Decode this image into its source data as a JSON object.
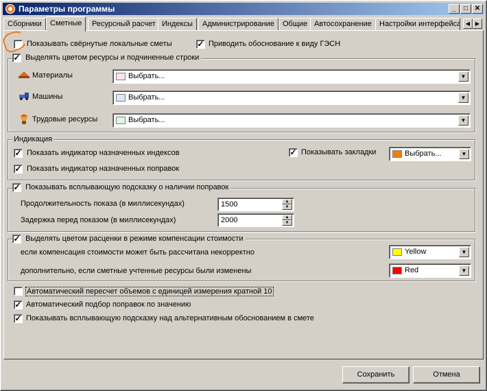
{
  "window": {
    "title": "Параметры программы",
    "controls": {
      "minimize": "_",
      "maximize": "□",
      "close": "✕"
    }
  },
  "tabs": [
    {
      "label": "Сборники"
    },
    {
      "label": "Сметные",
      "active": true
    },
    {
      "label": "Ресурсный расчет"
    },
    {
      "label": "Индексы"
    },
    {
      "label": "Администрирование"
    },
    {
      "label": "Общие"
    },
    {
      "label": "Автосохранение"
    },
    {
      "label": "Настройки интерфейса"
    }
  ],
  "options": {
    "show_collapsed": {
      "label": "Показывать свёрнутые локальные сметы",
      "checked": false
    },
    "gesn_basis": {
      "label": "Приводить обоснование к виду ГЭСН",
      "checked": true
    }
  },
  "highlight_group": {
    "label": "Выделять цветом ресурсы и подчиненные строки",
    "checked": true,
    "rows": [
      {
        "label": "Материалы",
        "icon": "materials-icon",
        "value": "Выбрать...",
        "color": "#fce4ec"
      },
      {
        "label": "Машины",
        "icon": "machines-icon",
        "value": "Выбрать...",
        "color": "#dde8f8"
      },
      {
        "label": "Трудовые ресурсы",
        "icon": "labor-icon",
        "value": "Выбрать...",
        "color": "#ddf5ea"
      }
    ]
  },
  "indication": {
    "title": "Индикация",
    "indexes": {
      "label": "Показать индикатор назначенных индексов",
      "checked": true
    },
    "corrections": {
      "label": "Показать индикатор назначенных поправок",
      "checked": true
    },
    "bookmarks": {
      "label": "Показывать закладки",
      "checked": true,
      "value": "Выбрать...",
      "color": "#f08000"
    }
  },
  "tooltip_group": {
    "label": "Показывать всплывающую подсказку о наличии поправок",
    "checked": true,
    "duration": {
      "label": "Продолжительность показа (в миллисекундах)",
      "value": "1500"
    },
    "delay": {
      "label": "Задержка перед показом (в миллисекундах)",
      "value": "2000"
    }
  },
  "compensation_group": {
    "label": "Выделять цветом расценки в режиме компенсации стоимости",
    "checked": true,
    "incorrect": {
      "label": "если компенсация стоимости может быть рассчитана некорректно",
      "value": "Yellow",
      "color": "#ffff00"
    },
    "changed": {
      "label": "дополнительно, если сметные учтенные ресурсы были изменены",
      "value": "Red",
      "color": "#ff0000"
    }
  },
  "bottom_options": [
    {
      "label": "Автоматический пересчет объемов с единицей измерения кратной 10",
      "checked": false
    },
    {
      "label": "Автоматический подбор поправок по значению",
      "checked": true
    },
    {
      "label": "Показывать всплывающую подсказку над альтернативным обоснованием в смете",
      "checked": true
    }
  ],
  "buttons": {
    "save": "Сохранить",
    "cancel": "Отмена"
  },
  "glyphs": {
    "check": "✓",
    "dropdown": "▼",
    "up": "▲",
    "down": "▼",
    "left": "◀",
    "right": "▶"
  }
}
